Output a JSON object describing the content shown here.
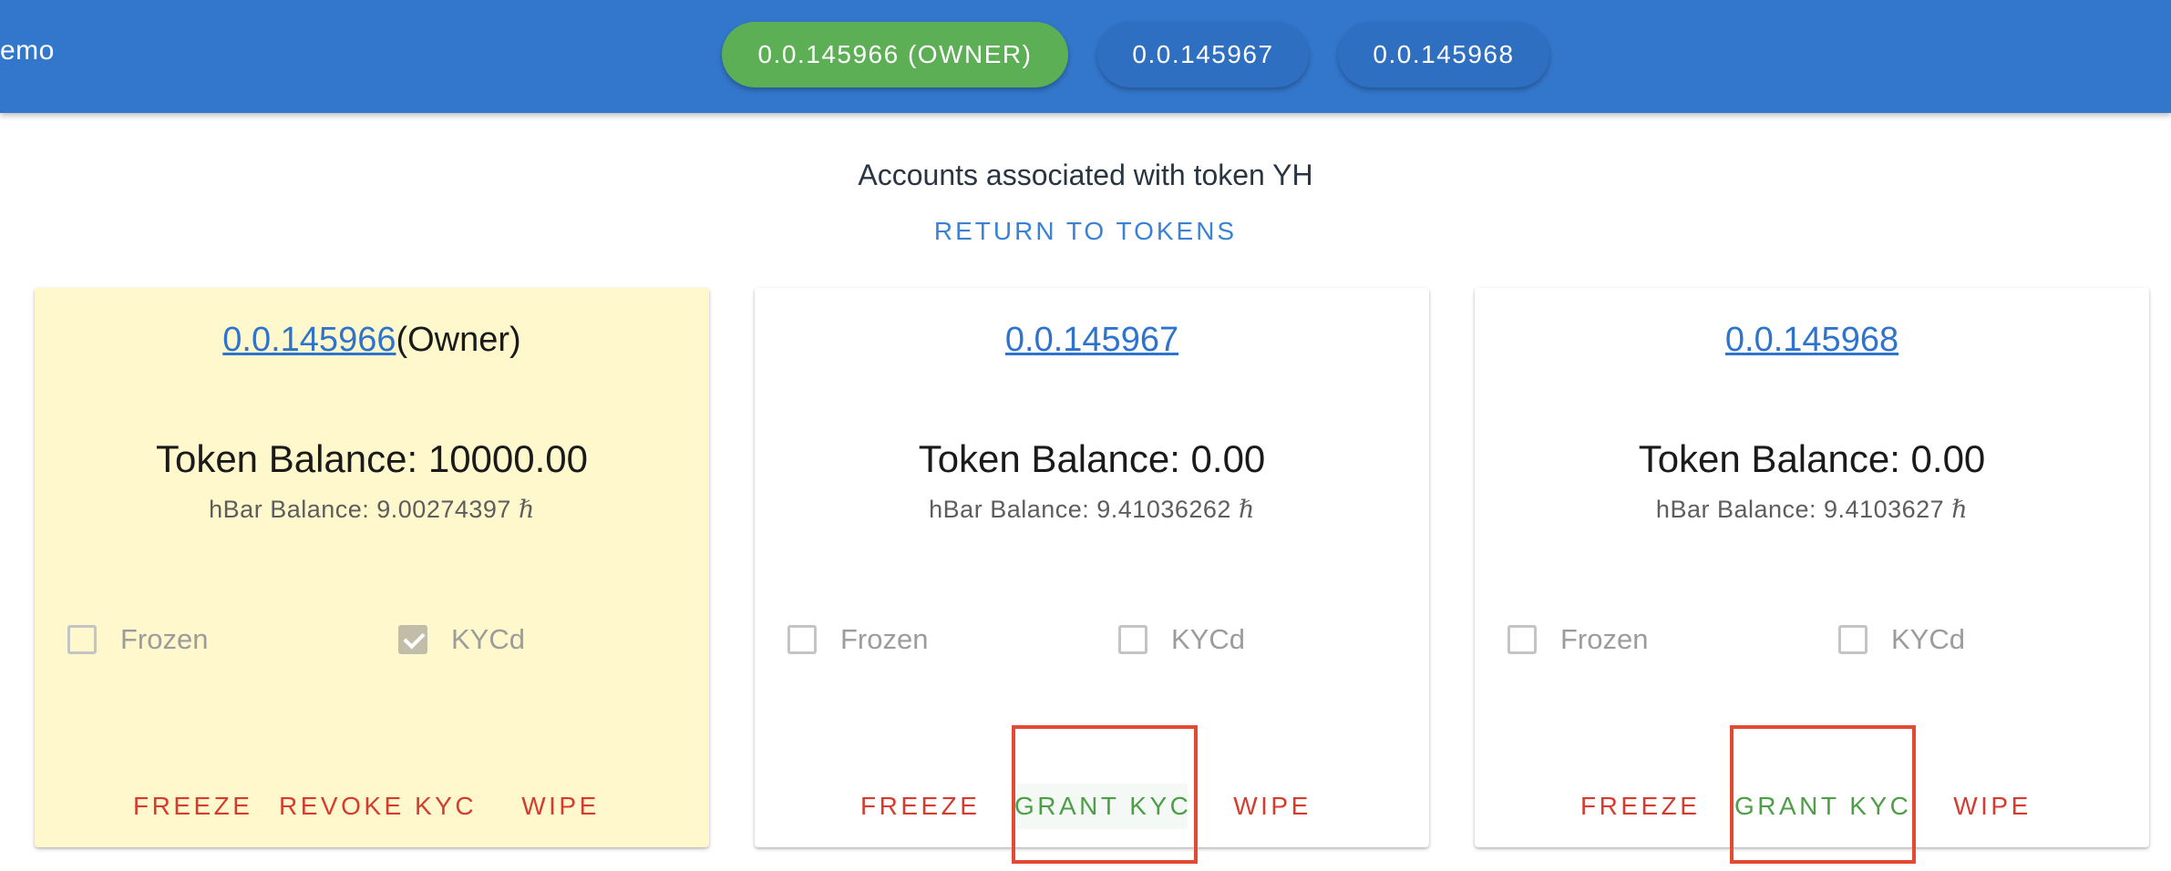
{
  "topbar": {
    "app_title": "emo",
    "accounts": [
      {
        "label": "0.0.145966 (OWNER)",
        "selected": true,
        "color": "#5caf54"
      },
      {
        "label": "0.0.145967",
        "selected": false,
        "color": "#2f6fc2"
      },
      {
        "label": "0.0.145968",
        "selected": false,
        "color": "#2f6fc2"
      }
    ],
    "color": "#3377cc"
  },
  "main": {
    "subtitle": "Accounts associated with token YH",
    "return_link": "RETURN TO TOKENS"
  },
  "cards": [
    {
      "account_id": "0.0.145966",
      "owner_suffix": "(Owner)",
      "token_balance": "Token Balance: 10000.00",
      "hbar_balance": "hBar Balance: 9.00274397",
      "hbar_symbol": "ℏ",
      "frozen_label": "Frozen",
      "frozen": false,
      "kyc_label": "KYCd",
      "kyc": true,
      "actions": [
        "FREEZE",
        "REVOKE KYC",
        "WIPE"
      ],
      "background": "#fff8cc"
    },
    {
      "account_id": "0.0.145967",
      "owner_suffix": "",
      "token_balance": "Token Balance: 0.00",
      "hbar_balance": "hBar Balance: 9.41036262",
      "hbar_symbol": "ℏ",
      "frozen_label": "Frozen",
      "frozen": false,
      "kyc_label": "KYCd",
      "kyc": false,
      "actions": [
        "FREEZE",
        "GRANT KYC",
        "WIPE"
      ],
      "background": "#ffffff"
    },
    {
      "account_id": "0.0.145968",
      "owner_suffix": "",
      "token_balance": "Token Balance: 0.00",
      "hbar_balance": "hBar Balance: 9.4103627",
      "hbar_symbol": "ℏ",
      "frozen_label": "Frozen",
      "frozen": false,
      "kyc_label": "KYCd",
      "kyc": false,
      "actions": [
        "FREEZE",
        "GRANT KYC",
        "WIPE"
      ],
      "background": "#ffffff"
    }
  ],
  "colors": {
    "link": "#2f74cc",
    "danger_action": "#d53b2e",
    "success_action": "#4e9e48",
    "annotation_box": "#e34a33"
  }
}
